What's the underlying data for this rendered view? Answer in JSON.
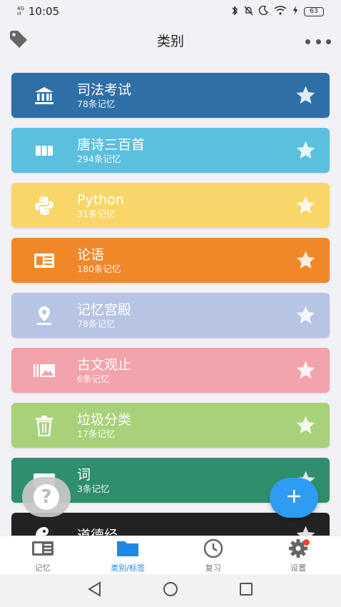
{
  "status_bar": {
    "network": "4G",
    "signal": "ııl",
    "time": "10:05",
    "battery": "63"
  },
  "header": {
    "title": "类别"
  },
  "categories": [
    {
      "name": "司法考试",
      "count": "78条记忆",
      "color": "#2e6fa8",
      "icon": "bank-icon"
    },
    {
      "name": "唐诗三百首",
      "count": "294条记忆",
      "color": "#5bc0de",
      "icon": "columns-icon"
    },
    {
      "name": "Python",
      "count": "31条记忆",
      "color": "#f8d66a",
      "icon": "python-icon"
    },
    {
      "name": "论语",
      "count": "180条记忆",
      "color": "#f0882a",
      "icon": "news-card-icon"
    },
    {
      "name": "记忆宫殿",
      "count": "78条记忆",
      "color": "#b8c4e4",
      "icon": "location-pin-icon"
    },
    {
      "name": "古文观止",
      "count": "6条记忆",
      "color": "#f2a3ab",
      "icon": "gallery-icon"
    },
    {
      "name": "垃圾分类",
      "count": "17条记忆",
      "color": "#a8d27a",
      "icon": "trash-icon"
    },
    {
      "name": "词",
      "count": "3条记忆",
      "color": "#2f8f6c",
      "icon": "card-icon"
    },
    {
      "name": "道德经",
      "count": "",
      "color": "#222222",
      "icon": "yin-yang-icon"
    }
  ],
  "bottom_nav": [
    {
      "label": "记忆",
      "icon": "memory-card-icon"
    },
    {
      "label": "类别/标签",
      "icon": "folder-icon"
    },
    {
      "label": "复习",
      "icon": "clock-icon"
    },
    {
      "label": "设置",
      "icon": "gear-icon"
    }
  ],
  "colors": {
    "accent": "#1e88e5",
    "fab": "#2f9cf4"
  },
  "fab": {
    "help": "?",
    "add": "+"
  }
}
